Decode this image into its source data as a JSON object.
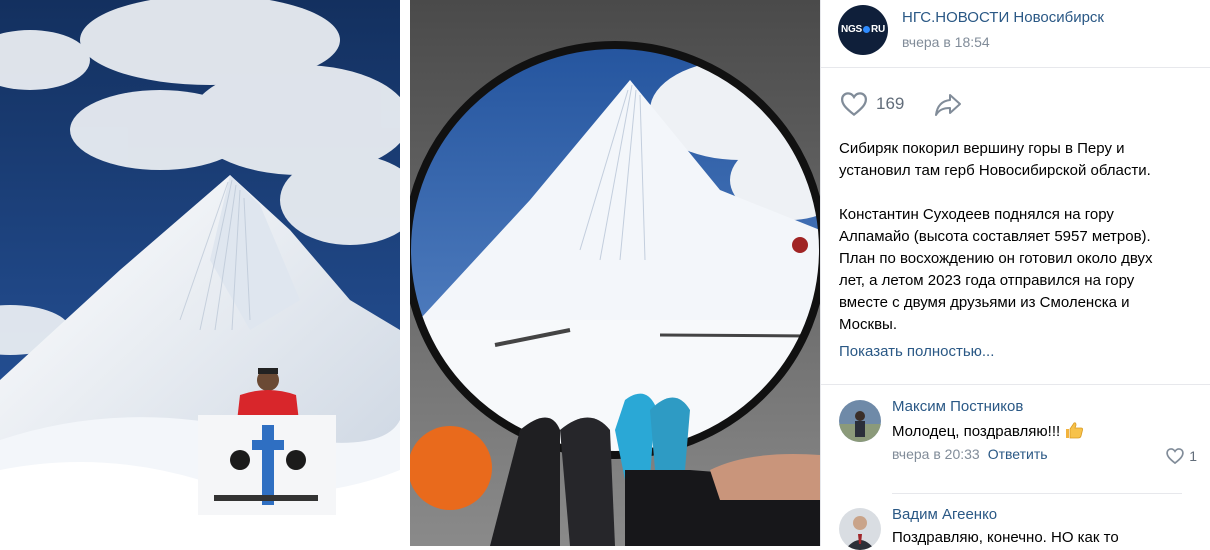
{
  "post": {
    "author": "НГС.НОВОСТИ Новосибирск",
    "avatar_text": "NGS",
    "avatar_text_suffix": "RU",
    "time": "вчера в 18:54",
    "likes": "169",
    "text_lines_1": [
      "Сибиряк покорил вершину горы в Перу и",
      "установил там герб Новосибирской области."
    ],
    "text_lines_2": [
      "Константин Суходеев поднялся на гору",
      "Алпамайо (высота составляет 5957 метров).",
      "План по восхождению он готовил около двух",
      "лет, а летом 2023 года отправился на гору",
      "вместе с двумя друзьями из Смоленска и",
      "Москвы."
    ],
    "show_more": "Показать полностью..."
  },
  "comments": [
    {
      "author": "Максим Постников",
      "text": "Молодец, поздравляю!!!",
      "emoji": "thumbs-up",
      "time": "вчера в 20:33",
      "reply": "Ответить",
      "likes": "1"
    },
    {
      "author": "Вадим Агеенко",
      "text": "Поздравляю, конечно. НО как то"
    }
  ],
  "colors": {
    "link": "#2a5885",
    "muted": "#818c99",
    "separator": "#e7e8ec",
    "avatar_bg": "#0f1f3a",
    "sky": "#1e3f7a",
    "snow": "#eef2f7",
    "jacket": "#d8262b"
  },
  "icons": [
    "heart-icon",
    "share-icon",
    "thumbs-up-icon"
  ]
}
